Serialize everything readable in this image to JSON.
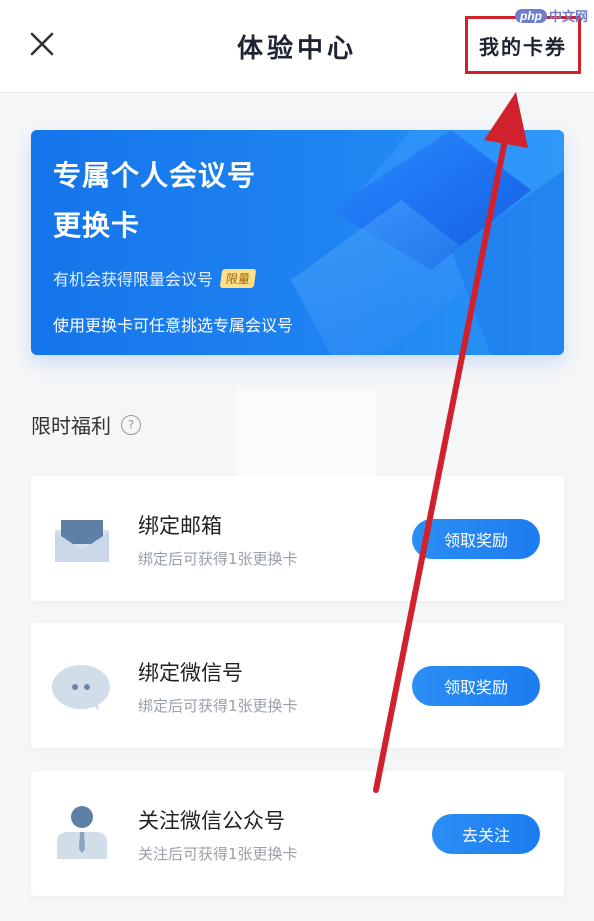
{
  "header": {
    "title": "体验中心",
    "right_link": "我的卡券"
  },
  "watermark": {
    "logo": "php",
    "text": "中文网"
  },
  "banner": {
    "title_line1": "专属个人会议号",
    "title_line2": "更换卡",
    "subtitle": "有机会获得限量会议号",
    "badge": "限量",
    "description": "使用更换卡可任意挑选专属会议号"
  },
  "section": {
    "title": "限时福利",
    "help_icon_glyph": "?"
  },
  "tasks": [
    {
      "icon": "envelope-icon",
      "title": "绑定邮箱",
      "desc": "绑定后可获得1张更换卡",
      "button": "领取奖励"
    },
    {
      "icon": "chat-bubble-icon",
      "title": "绑定微信号",
      "desc": "绑定后可获得1张更换卡",
      "button": "领取奖励"
    },
    {
      "icon": "person-icon",
      "title": "关注微信公众号",
      "desc": "关注后可获得1张更换卡",
      "button": "去关注"
    }
  ],
  "colors": {
    "accent": "#1e7ff0",
    "annotation_red": "#d0212c"
  }
}
